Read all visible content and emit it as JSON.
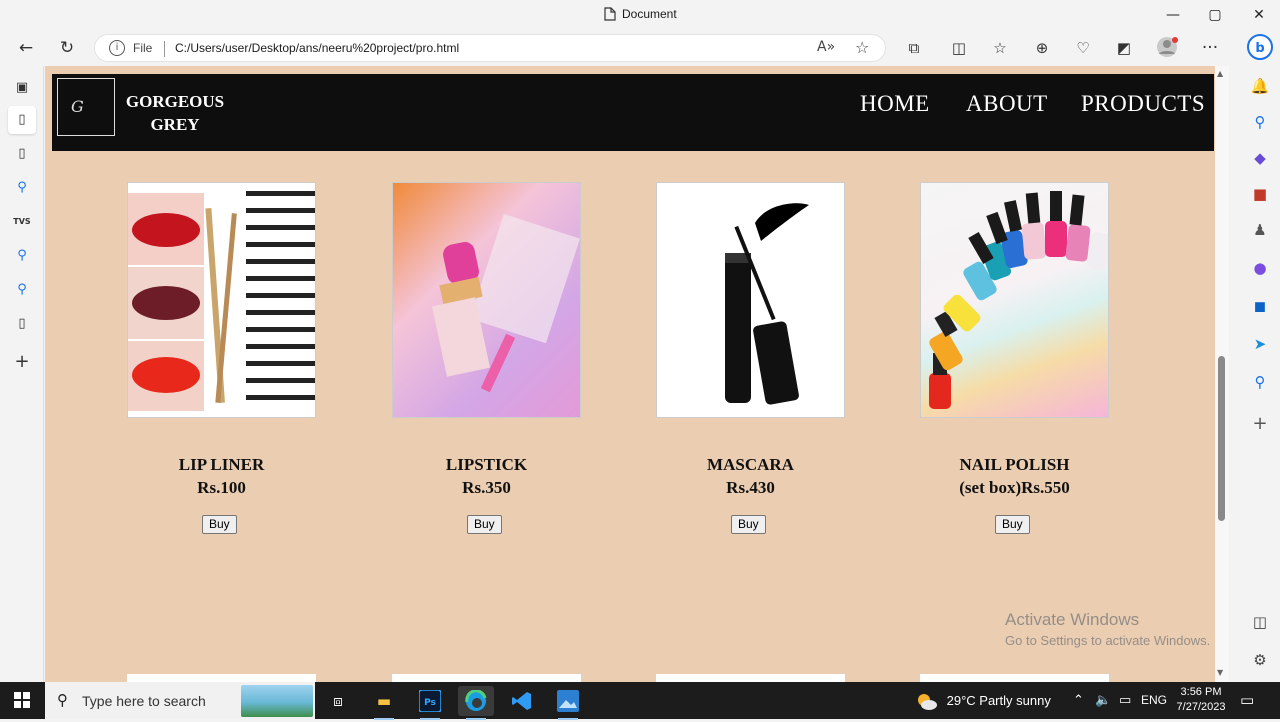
{
  "window": {
    "title": "Document",
    "controls": {
      "minimize": "—",
      "maximize": "▢",
      "close": "✕"
    }
  },
  "toolbar": {
    "back": "←",
    "refresh": "↻",
    "address": {
      "scheme_label": "File",
      "url": "C:/Users/user/Desktop/ans/neeru%20project/pro.html",
      "read_aloud": "A»",
      "favorite": "☆"
    },
    "more": "···"
  },
  "page": {
    "logo_mark": "G",
    "brand": "GORGEOUS GREY",
    "nav": [
      "HOME",
      "ABOUT",
      "PRODUCTS"
    ],
    "products": [
      {
        "name": "LIP LINER",
        "price": "Rs.100",
        "button": "Buy"
      },
      {
        "name": "LIPSTICK",
        "price": "Rs.350",
        "button": "Buy"
      },
      {
        "name": "MASCARA",
        "price": "Rs.430",
        "button": "Buy"
      },
      {
        "name": "NAIL POLISH",
        "price": "(set box)Rs.550",
        "button": "Buy"
      }
    ]
  },
  "watermark": {
    "line1": "Activate Windows",
    "line2": "Go to Settings to activate Windows."
  },
  "taskbar": {
    "search_placeholder": "Type here to search",
    "weather": "29°C  Partly sunny",
    "language": "ENG",
    "time": "3:56 PM",
    "date": "7/27/2023"
  },
  "colors": {
    "page_bg": "#ebcdb2",
    "navbar_bg": "#0e0e0e",
    "taskbar_bg": "#1c1c1c"
  }
}
